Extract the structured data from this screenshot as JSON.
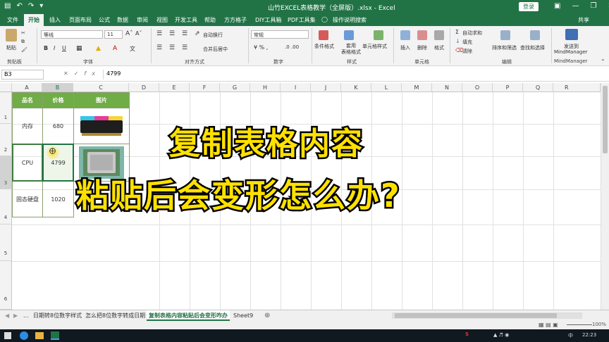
{
  "titlebar": {
    "title": "山竹EXCEL表格教学（全屏版）.xlsx - Excel",
    "login": "登录",
    "qa_icons": [
      "save-icon",
      "undo-icon",
      "redo-icon",
      "qat-more-icon"
    ]
  },
  "menu": [
    "文件",
    "开始",
    "插入",
    "页面布局",
    "公式",
    "数据",
    "审阅",
    "视图",
    "开发工具",
    "帮助",
    "方方格子",
    "DIY工具箱",
    "PDF工具集",
    "操作说明搜索"
  ],
  "share": "共享",
  "ribbon": {
    "paste": "粘贴",
    "clipboard": "剪贴板",
    "font_name": "等线",
    "font_size": "11",
    "font_group": "字体",
    "wrap": "自动换行",
    "merge": "合并后居中",
    "align_group": "对齐方式",
    "number_format": "常规",
    "number_group": "数字",
    "cond_format": "条件格式",
    "table_format": "套用\n表格格式",
    "cell_style": "单元格样式",
    "style_group": "样式",
    "insert": "插入",
    "delete": "删除",
    "format": "格式",
    "cells_group": "单元格",
    "autosum": "自动求和",
    "fill": "填充",
    "clear": "清除",
    "sort": "排序和筛选",
    "find": "查找和选择",
    "edit_group": "编辑",
    "send_to": "发送到",
    "mindmanager": "MindManager",
    "mm_group": "MindManager"
  },
  "formula": {
    "namebox": "B3",
    "value": "4799"
  },
  "columns": [
    "A",
    "B",
    "C",
    "D",
    "E",
    "F",
    "G",
    "H",
    "I",
    "J",
    "K",
    "L",
    "M",
    "N",
    "O",
    "P",
    "Q",
    "R"
  ],
  "rows": [
    "1",
    "2",
    "3",
    "4",
    "5",
    "6"
  ],
  "table": {
    "headers": [
      "品名",
      "价格",
      "图片"
    ],
    "rows": [
      {
        "name": "内存",
        "price": "680"
      },
      {
        "name": "CPU",
        "price": "4799"
      },
      {
        "name": "固态硬盘",
        "price": "1020"
      }
    ]
  },
  "overlay": {
    "line1": "复制表格内容",
    "line2": "粘贴后会变形怎么办?"
  },
  "tabs": [
    "...",
    "日期转8位数字样式",
    "怎么把8位数字转成日期",
    "复制表格内容粘贴后会变形咋办",
    "Sheet9"
  ],
  "status": {
    "zoom": "100%"
  },
  "taskbar": {
    "time": "22:23",
    "lang": "中"
  }
}
